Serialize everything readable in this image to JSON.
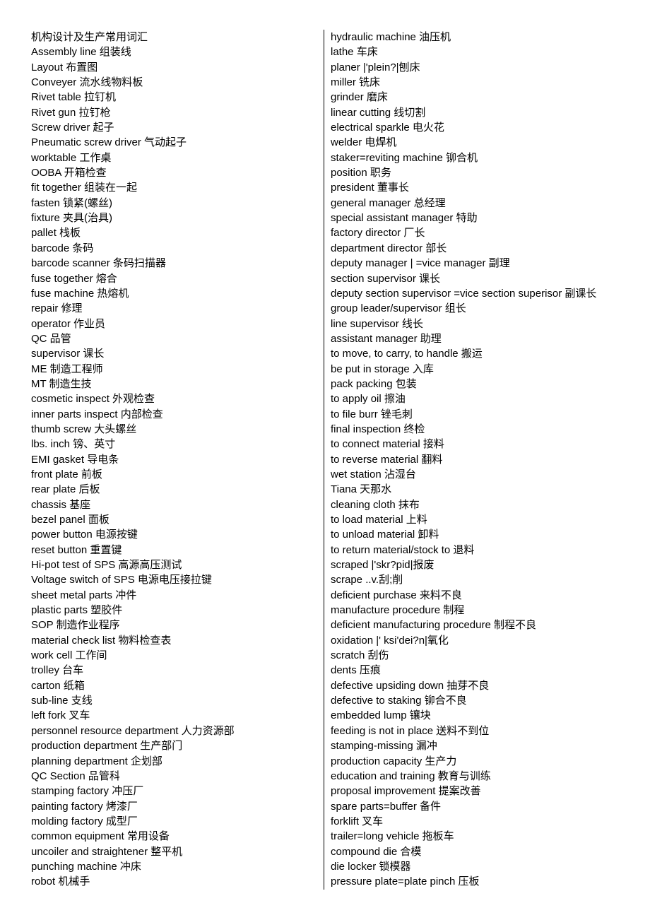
{
  "document": {
    "title": "机构设计及生产常用词汇",
    "layout": "two-column glossary with vertical divider rule"
  },
  "left_column": {
    "entries": [
      "机构设计及生产常用词汇",
      "Assembly line 组装线",
      "Layout 布置图",
      "Conveyer 流水线物料板",
      "Rivet table 拉钉机",
      "Rivet gun 拉钉枪",
      "Screw driver 起子",
      "Pneumatic screw driver 气动起子",
      "worktable 工作桌",
      "OOBA 开箱检查",
      "fit together 组装在一起",
      "fasten 锁紧(螺丝)",
      "fixture 夹具(治具)",
      "pallet 栈板",
      "barcode 条码",
      "barcode scanner 条码扫描器",
      "fuse together 熔合",
      "fuse machine 热熔机",
      "repair 修理",
      "operator 作业员",
      "QC 品管",
      "supervisor 课长",
      "ME 制造工程师",
      "MT 制造生技",
      "cosmetic inspect 外观检查",
      "inner parts inspect 内部检查",
      "thumb screw 大头螺丝",
      "lbs. inch 镑、英寸",
      "EMI gasket 导电条",
      "front plate 前板",
      "rear plate 后板",
      "chassis 基座",
      "bezel panel 面板",
      "power button 电源按键",
      "reset button 重置键",
      "Hi-pot test of SPS 高源高压测试",
      "Voltage switch of SPS 电源电压接拉键",
      "sheet metal parts 冲件",
      "plastic parts 塑胶件",
      "SOP 制造作业程序",
      "material check list 物料检查表",
      "work cell 工作间",
      "trolley 台车",
      "carton 纸箱",
      "sub-line 支线",
      "left fork 叉车",
      "personnel resource department 人力资源部",
      "production department 生产部门",
      "planning department 企划部",
      "QC Section 品管科",
      "stamping factory 冲压厂",
      "painting factory 烤漆厂",
      "molding factory 成型厂",
      "common equipment 常用设备",
      "uncoiler and straightener 整平机",
      "punching machine 冲床",
      "robot 机械手"
    ]
  },
  "right_column": {
    "entries": [
      "hydraulic machine 油压机",
      "lathe 车床",
      "planer |'plein?|刨床",
      "miller 铣床",
      "grinder 磨床",
      "linear cutting 线切割",
      "electrical sparkle 电火花",
      "welder 电焊机",
      "staker=reviting machine 铆合机",
      "position 职务",
      "president 董事长",
      "general manager 总经理",
      "special assistant manager 特助",
      "factory director 厂长",
      "department director 部长",
      "deputy manager | =vice manager 副理",
      "section supervisor 课长",
      "deputy section supervisor =vice section superisor 副课长",
      "group leader/supervisor 组长",
      "line supervisor 线长",
      "assistant manager 助理",
      "to move, to carry, to handle 搬运",
      "be put in storage 入库",
      "pack packing 包装",
      "to apply oil 擦油",
      "to file burr 锉毛刺",
      "final inspection 终检",
      "to connect material 接料",
      "to reverse material 翻料",
      "wet station 沾湿台",
      "Tiana 天那水",
      "cleaning cloth 抹布",
      "to load material 上料",
      "to unload material 卸料",
      "to return material/stock to 退料",
      "scraped |'skr?pid|报废",
      "scrape ..v.刮;削",
      "deficient purchase 来料不良",
      "manufacture procedure 制程",
      "deficient manufacturing procedure 制程不良",
      "oxidation |' ksi'dei?n|氧化",
      "scratch 刮伤",
      "dents 压痕",
      "defective upsiding down 抽芽不良",
      "defective to staking 铆合不良",
      "embedded lump 镶块",
      "feeding is not in place 送料不到位",
      "stamping-missing 漏冲",
      "production capacity 生产力",
      "education and training 教育与训练",
      "proposal improvement 提案改善",
      "spare parts=buffer 备件",
      "forklift 叉车",
      "trailer=long vehicle 拖板车",
      "compound die 合模",
      "die locker 锁模器",
      "pressure plate=plate pinch 压板"
    ]
  }
}
